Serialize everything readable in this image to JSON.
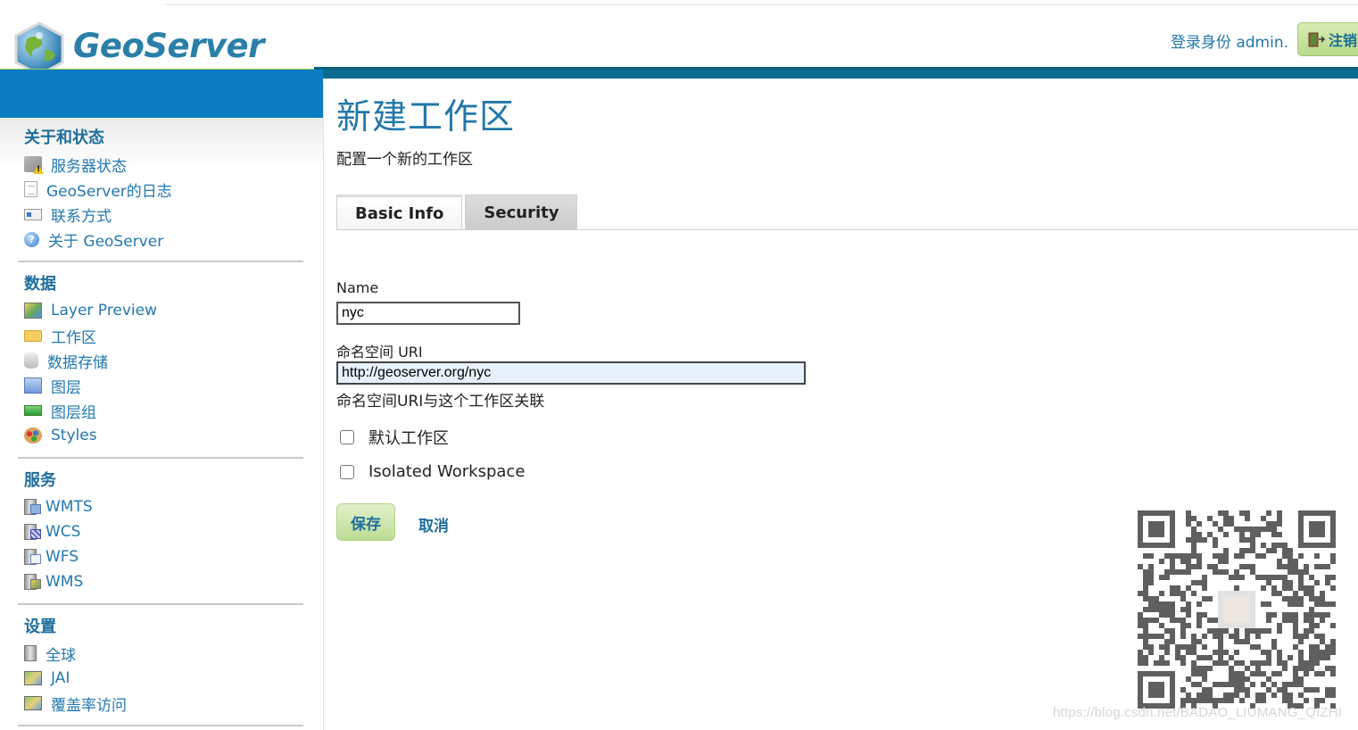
{
  "header": {
    "app_name": "GeoServer",
    "login_text": "登录身份 admin.",
    "logout_label": "注销"
  },
  "sidebar": {
    "sections": [
      {
        "title": "关于和状态",
        "items": [
          {
            "label": "服务器状态",
            "icon": "server-status-icon"
          },
          {
            "label": "GeoServer的日志",
            "icon": "log-document-icon"
          },
          {
            "label": "联系方式",
            "icon": "contact-card-icon"
          },
          {
            "label": "关于 GeoServer",
            "icon": "help-icon"
          }
        ]
      },
      {
        "title": "数据",
        "items": [
          {
            "label": "Layer Preview",
            "icon": "map-preview-icon"
          },
          {
            "label": "工作区",
            "icon": "folder-icon"
          },
          {
            "label": "数据存储",
            "icon": "database-icon"
          },
          {
            "label": "图层",
            "icon": "layer-icon"
          },
          {
            "label": "图层组",
            "icon": "layer-group-icon"
          },
          {
            "label": "Styles",
            "icon": "palette-icon"
          }
        ]
      },
      {
        "title": "服务",
        "items": [
          {
            "label": "WMTS",
            "icon": "wmts-service-icon"
          },
          {
            "label": "WCS",
            "icon": "wcs-service-icon"
          },
          {
            "label": "WFS",
            "icon": "wfs-service-icon"
          },
          {
            "label": "WMS",
            "icon": "wms-service-icon"
          }
        ]
      },
      {
        "title": "设置",
        "items": [
          {
            "label": "全球",
            "icon": "global-settings-icon"
          },
          {
            "label": "JAI",
            "icon": "jai-icon"
          },
          {
            "label": "覆盖率访问",
            "icon": "coverage-access-icon"
          }
        ]
      }
    ]
  },
  "main": {
    "title": "新建工作区",
    "description": "配置一个新的工作区",
    "tabs": [
      {
        "label": "Basic Info",
        "active": true
      },
      {
        "label": "Security",
        "active": false
      }
    ],
    "form": {
      "name_label": "Name",
      "name_value": "nyc",
      "uri_label": "命名空间 URI",
      "uri_value": "http://geoserver.org/nyc",
      "uri_hint": "命名空间URI与这个工作区关联",
      "default_label": "默认工作区",
      "default_checked": false,
      "isolated_label": "Isolated Workspace",
      "isolated_checked": false
    },
    "save_label": "保存",
    "cancel_label": "取消"
  },
  "watermark": "https://blog.csdn.net/BADAO_LIUMANG_QIZHI",
  "colors": {
    "brand_blue": "#0b7cc0",
    "header_dark": "#0b6a8e",
    "link_blue": "#2278b0",
    "save_green": "#bcdc93"
  }
}
